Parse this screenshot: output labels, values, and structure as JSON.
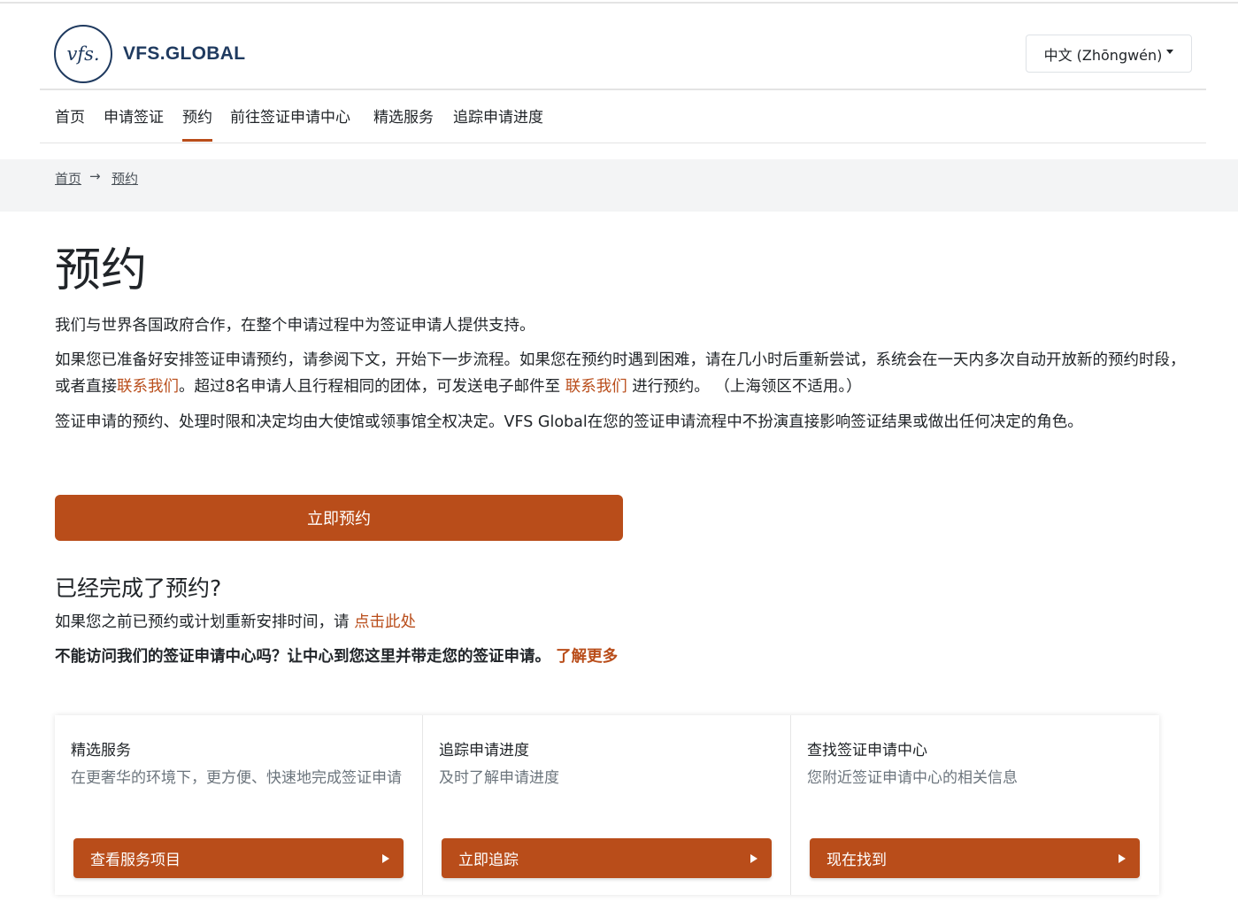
{
  "header": {
    "logo_mark": "vfs.",
    "logo_text": "VFS.GLOBAL",
    "language": "中文 (Zhōngwén)"
  },
  "nav": {
    "items": [
      "首页",
      "申请签证",
      "预约",
      "前往签证申请中心",
      "精选服务",
      "追踪申请进度"
    ],
    "active_index": 2
  },
  "breadcrumb": {
    "home": "首页",
    "separator": "→",
    "current": "预约"
  },
  "main": {
    "title": "预约",
    "para1": "我们与世界各国政府合作，在整个申请过程中为签证申请人提供支持。",
    "para2_part1": "如果您已准备好安排签证申请预约，请参阅下文，开始下一步流程。如果您在预约时遇到困难，请在几小时后重新尝试，系统会在一天内多次自动开放新的预约时段，或者直接",
    "para2_link1": "联系我们",
    "para2_part2": "。超过8名申请人且行程相同的团体，可发送电子邮件至 ",
    "para2_link2": "联系我们",
    "para2_part3": " 进行预约。 （上海领区不适用。）",
    "para3": "签证申请的预约、处理时限和决定均由大使馆或领事馆全权决定。VFS Global在您的签证申请流程中不扮演直接影响签证结果或做出任何决定的角色。",
    "cta_label": "立即预约",
    "subtitle": "已经完成了预约?",
    "reschedule_text": "如果您之前已预约或计划重新安排时间，请 ",
    "reschedule_link": "点击此处",
    "mobile_text": "不能访问我们的签证申请中心吗？让中心到您这里并带走您的签证申请。 ",
    "mobile_link": "了解更多"
  },
  "cards": [
    {
      "title": "精选服务",
      "desc": "在更奢华的环境下，更方便、快速地完成签证申请",
      "button": "查看服务项目"
    },
    {
      "title": "追踪申请进度",
      "desc": "及时了解申请进度",
      "button": "立即追踪"
    },
    {
      "title": "查找签证申请中心",
      "desc": "您附近签证申请中心的相关信息",
      "button": "现在找到"
    }
  ],
  "colors": {
    "accent": "#b94d1a",
    "brand": "#1f3a5f",
    "breadcrumb_bg": "#f3f4f5"
  }
}
